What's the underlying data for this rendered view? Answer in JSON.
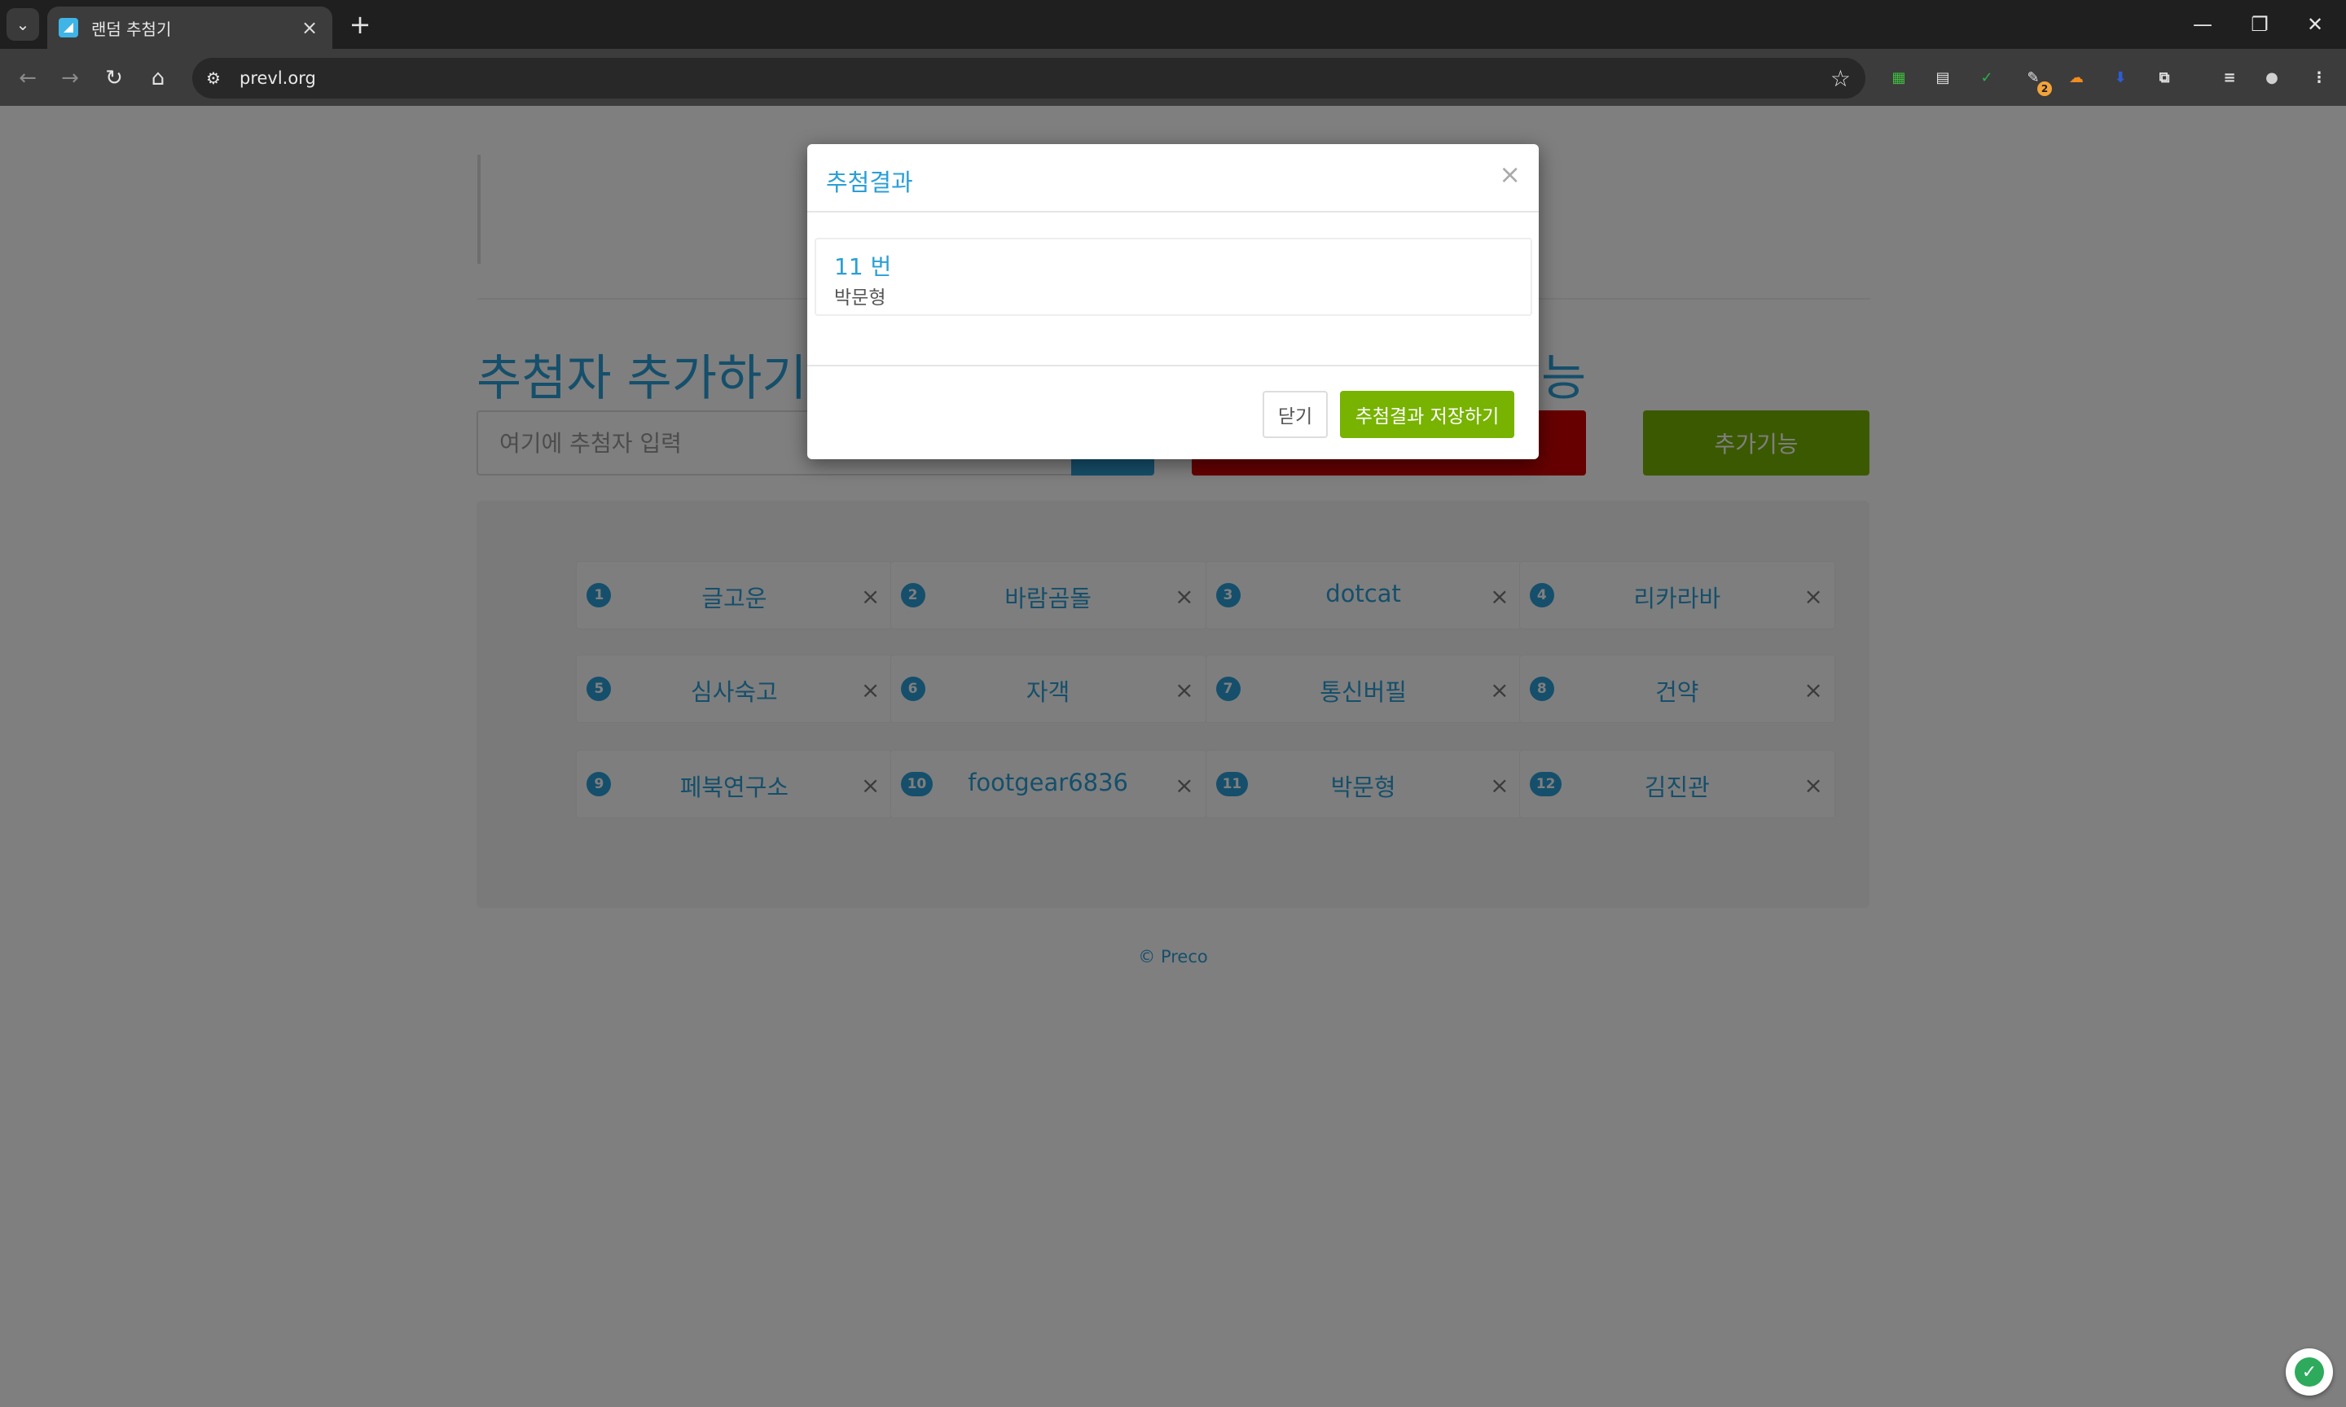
{
  "browser": {
    "tab_title": "랜덤 추첨기",
    "url": "prevl.org",
    "tab_search_icon": "chevron-down-icon",
    "new_tab_glyph": "+",
    "close_glyph": "×",
    "extensions": [
      {
        "name": "extension-green-icon",
        "color": "#3fbf3f",
        "glyph": "▦"
      },
      {
        "name": "extension-doc-icon",
        "color": "#e6e6e6",
        "glyph": "▤"
      },
      {
        "name": "extension-shield-icon",
        "color": "#27b24a",
        "glyph": "✓"
      },
      {
        "name": "extension-badge-icon",
        "color": "#e6e6e6",
        "glyph": "✎",
        "badge": "2"
      },
      {
        "name": "extension-cloud-icon",
        "color": "#f28b20",
        "glyph": "☁"
      },
      {
        "name": "extension-download-icon",
        "color": "#2f5bd3",
        "glyph": "⬇"
      },
      {
        "name": "extensions-puzzle-icon",
        "color": "#e3e3e3",
        "glyph": "⧉"
      },
      {
        "name": "reading-list-icon",
        "color": "#e3e3e3",
        "glyph": "≡"
      },
      {
        "name": "profile-avatar-icon",
        "color": "#d0d0d0",
        "glyph": "●"
      },
      {
        "name": "browser-menu-icon",
        "color": "#e3e3e3",
        "glyph": "⋮"
      }
    ]
  },
  "page": {
    "section_title": "추첨자 추가하기",
    "section_title_right_fragment": "능",
    "input_placeholder": "여기에 추첨자 입력",
    "extra_button_label": "추가기능",
    "participants": [
      {
        "num": "1",
        "name": "글고운"
      },
      {
        "num": "2",
        "name": "바람곰돌"
      },
      {
        "num": "3",
        "name": "dotcat"
      },
      {
        "num": "4",
        "name": "리카라바"
      },
      {
        "num": "5",
        "name": "심사숙고"
      },
      {
        "num": "6",
        "name": "자객"
      },
      {
        "num": "7",
        "name": "통신버필"
      },
      {
        "num": "8",
        "name": "건약"
      },
      {
        "num": "9",
        "name": "페북연구소"
      },
      {
        "num": "10",
        "name": "footgear6836"
      },
      {
        "num": "11",
        "name": "박문형"
      },
      {
        "num": "12",
        "name": "김진관"
      }
    ],
    "remove_glyph": "×",
    "footer": "© Preco"
  },
  "modal": {
    "title": "추첨결과",
    "close_glyph": "×",
    "result_number": "11 번",
    "result_name": "박문형",
    "close_button": "닫기",
    "save_button": "추첨결과 저장하기"
  },
  "colors": {
    "accent": "#2a9fd6",
    "success": "#77b300",
    "danger": "#cc0000"
  }
}
